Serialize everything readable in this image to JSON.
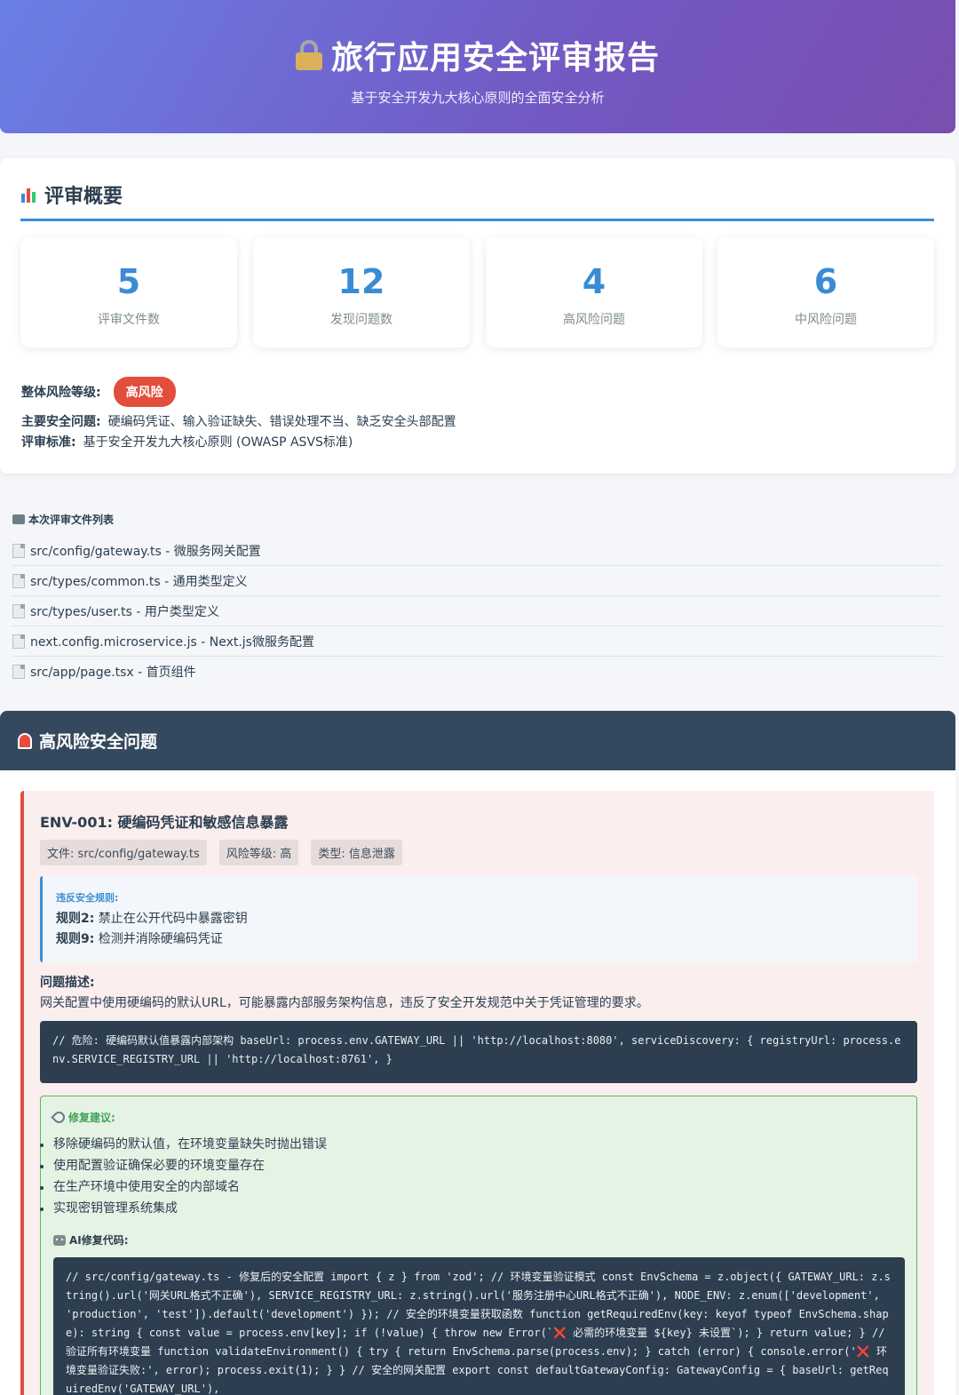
{
  "header": {
    "title": "旅行应用安全评审报告",
    "subtitle": "基于安全开发九大核心原则的全面安全分析"
  },
  "overview": {
    "title": "评审概要",
    "stats": [
      {
        "value": "5",
        "label": "评审文件数"
      },
      {
        "value": "12",
        "label": "发现问题数"
      },
      {
        "value": "4",
        "label": "高风险问题"
      },
      {
        "value": "6",
        "label": "中风险问题"
      }
    ],
    "risk_label": "整体风险等级:",
    "risk_value": "高风险",
    "main_issues_label": "主要安全问题:",
    "main_issues_value": "硬编码凭证、输入验证缺失、错误处理不当、缺乏安全头部配置",
    "standard_label": "评审标准:",
    "standard_value": "基于安全开发九大核心原则 (OWASP ASVS标准)"
  },
  "files": {
    "title": "本次评审文件列表",
    "items": [
      "src/config/gateway.ts - 微服务网关配置",
      "src/types/common.ts - 通用类型定义",
      "src/types/user.ts - 用户类型定义",
      "next.config.microservice.js - Next.js微服务配置",
      "src/app/page.tsx - 首页组件"
    ]
  },
  "high_risk": {
    "title": "高风险安全问题",
    "issue": {
      "title": "ENV-001: 硬编码凭证和敏感信息暴露",
      "tags": [
        "文件: src/config/gateway.ts",
        "风险等级: 高",
        "类型: 信息泄露"
      ],
      "rules_caption": "违反安全规则:",
      "rules": [
        {
          "key": "规则2:",
          "text": " 禁止在公开代码中暴露密钥"
        },
        {
          "key": "规则9:",
          "text": " 检测并消除硬编码凭证"
        }
      ],
      "desc_caption": "问题描述:",
      "desc": "网关配置中使用硬编码的默认URL，可能暴露内部服务架构信息，违反了安全开发规范中关于凭证管理的要求。",
      "code": "// 危险: 硬编码默认值暴露内部架构 baseUrl: process.env.GATEWAY_URL || 'http://localhost:8080', serviceDiscovery: { registryUrl: process.env.SERVICE_REGISTRY_URL || 'http://localhost:8761', }",
      "fix_caption": "修复建议:",
      "fixes": [
        "移除硬编码的默认值，在环境变量缺失时抛出错误",
        "使用配置验证确保必要的环境变量存在",
        "在生产环境中使用安全的内部域名",
        "实现密钥管理系统集成"
      ],
      "ai_caption": "AI修复代码:",
      "ai_code": "// src/config/gateway.ts - 修复后的安全配置 import { z } from 'zod'; // 环境变量验证模式 const EnvSchema = z.object({ GATEWAY_URL: z.string().url('网关URL格式不正确'), SERVICE_REGISTRY_URL: z.string().url('服务注册中心URL格式不正确'), NODE_ENV: z.enum(['development', 'production', 'test']).default('development') }); // 安全的环境变量获取函数 function getRequiredEnv(key: keyof typeof EnvSchema.shape): string { const value = process.env[key]; if (!value) { throw new Error(`❌ 必需的环境变量 ${key} 未设置`); } return value; } // 验证所有环境变量 function validateEnvironment() { try { return EnvSchema.parse(process.env); } catch (error) { console.error('❌ 环境变量验证失败:', error); process.exit(1); } } // 安全的网关配置 export const defaultGatewayConfig: GatewayConfig = { baseUrl: getRequiredEnv('GATEWAY_URL'),"
    }
  }
}
